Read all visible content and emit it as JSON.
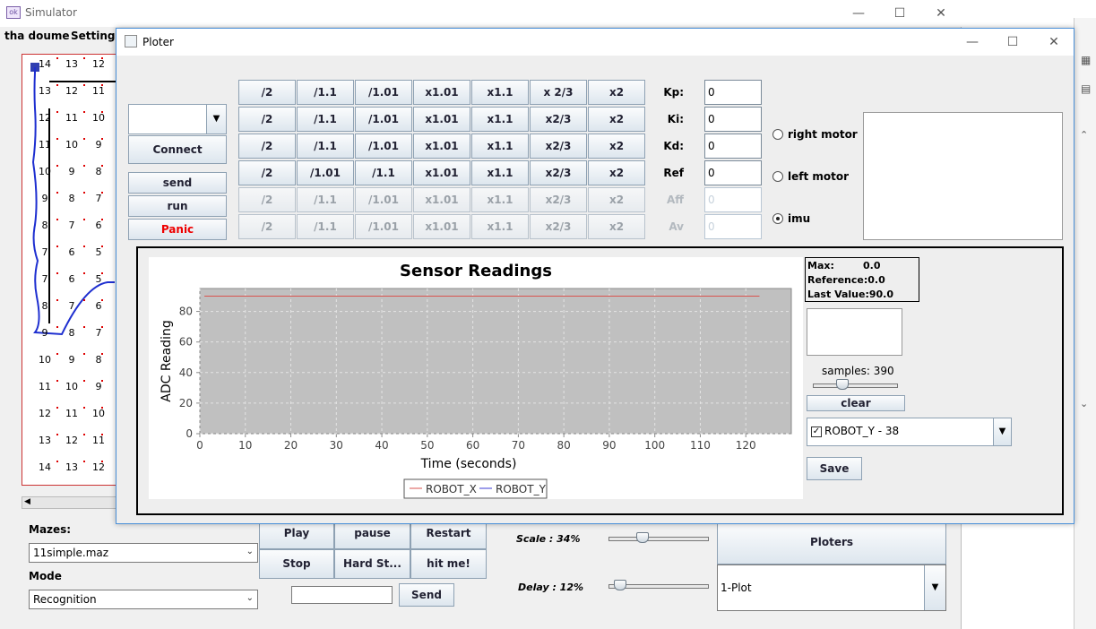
{
  "simulator": {
    "title": "Simulator",
    "menu": [
      "tha doume",
      "Settings"
    ],
    "maze_numbers": [
      [
        "14",
        "13",
        "12"
      ],
      [
        "13",
        "12",
        "11"
      ],
      [
        "12",
        "11",
        "10"
      ],
      [
        "11",
        "10",
        "9"
      ],
      [
        "10",
        "9",
        "8"
      ],
      [
        "9",
        "8",
        "7"
      ],
      [
        "8",
        "7",
        "6"
      ],
      [
        "7",
        "6",
        "5"
      ],
      [
        "7",
        "6",
        "5"
      ],
      [
        "8",
        "7",
        "6"
      ],
      [
        "9",
        "8",
        "7"
      ],
      [
        "10",
        "9",
        "8"
      ],
      [
        "11",
        "10",
        "9"
      ],
      [
        "12",
        "11",
        "10"
      ],
      [
        "13",
        "12",
        "11"
      ],
      [
        "14",
        "13",
        "12"
      ]
    ],
    "mazes_label": "Mazes:",
    "maze_file": "11simple.maz",
    "mode_label": "Mode",
    "mode_value": "Recognition",
    "buttons": {
      "play": "Play",
      "pause": "pause",
      "restart": "Restart",
      "stop": "Stop",
      "hard_stop": "Hard St...",
      "hit": "hit me!",
      "send": "Send",
      "ploters": "Ploters"
    },
    "send_input": "",
    "scale_label": "Scale : 34%",
    "scale_value": 34,
    "delay_label": "Delay : 12%",
    "delay_value": 12,
    "plot_select": "1-Plot"
  },
  "ploter": {
    "title": "Ploter",
    "connect": "Connect",
    "send": "send",
    "run": "run",
    "panic": "Panic",
    "port_value": "",
    "gain_rows": [
      {
        "buttons": [
          "/2",
          "/1.1",
          "/1.01",
          "x1.01",
          "x1.1",
          "x 2/3",
          "x2"
        ],
        "label": "Kp:",
        "value": "0",
        "enabled": true
      },
      {
        "buttons": [
          "/2",
          "/1.1",
          "/1.01",
          "x1.01",
          "x1.1",
          "x2/3",
          "x2"
        ],
        "label": "Ki:",
        "value": "0",
        "enabled": true
      },
      {
        "buttons": [
          "/2",
          "/1.1",
          "/1.01",
          "x1.01",
          "x1.1",
          "x2/3",
          "x2"
        ],
        "label": "Kd:",
        "value": "0",
        "enabled": true
      },
      {
        "buttons": [
          "/2",
          "/1.01",
          "/1.1",
          "x1.01",
          "x1.1",
          "x2/3",
          "x2"
        ],
        "label": "Ref",
        "value": "0",
        "enabled": true
      },
      {
        "buttons": [
          "/2",
          "/1.1",
          "/1.01",
          "x1.01",
          "x1.1",
          "x2/3",
          "x2"
        ],
        "label": "Aff",
        "value": "0",
        "enabled": false
      },
      {
        "buttons": [
          "/2",
          "/1.1",
          "/1.01",
          "x1.01",
          "x1.1",
          "x2/3",
          "x2"
        ],
        "label": "Av",
        "value": "0",
        "enabled": false
      }
    ],
    "radios": [
      {
        "label": "right motor",
        "selected": false
      },
      {
        "label": "left motor",
        "selected": false
      },
      {
        "label": "imu",
        "selected": true
      }
    ],
    "stats": {
      "max_label": "Max:",
      "max_value": "0.0",
      "ref_label": "Reference:",
      "ref_value": "0.0",
      "last_label": "Last Value:",
      "last_value": "90.0"
    },
    "samples_label": "samples: 390",
    "samples_value": 390,
    "clear": "clear",
    "series_select": "ROBOT_Y - 38",
    "save": "Save"
  },
  "chart_data": {
    "type": "line",
    "title": "Sensor Readings",
    "xlabel": "Time (seconds)",
    "ylabel": "ADC Reading",
    "xlim": [
      0,
      130
    ],
    "ylim": [
      0,
      95
    ],
    "xticks": [
      0,
      10,
      20,
      30,
      40,
      50,
      60,
      70,
      80,
      90,
      100,
      110,
      120
    ],
    "yticks": [
      0,
      20,
      40,
      60,
      80
    ],
    "grid": true,
    "legend": "bottom",
    "series": [
      {
        "name": "ROBOT_X",
        "color": "#d9534f",
        "x": [
          1,
          123
        ],
        "y": [
          90,
          90
        ]
      },
      {
        "name": "ROBOT_Y",
        "color": "#3b3bd6",
        "x": [],
        "y": []
      }
    ]
  }
}
